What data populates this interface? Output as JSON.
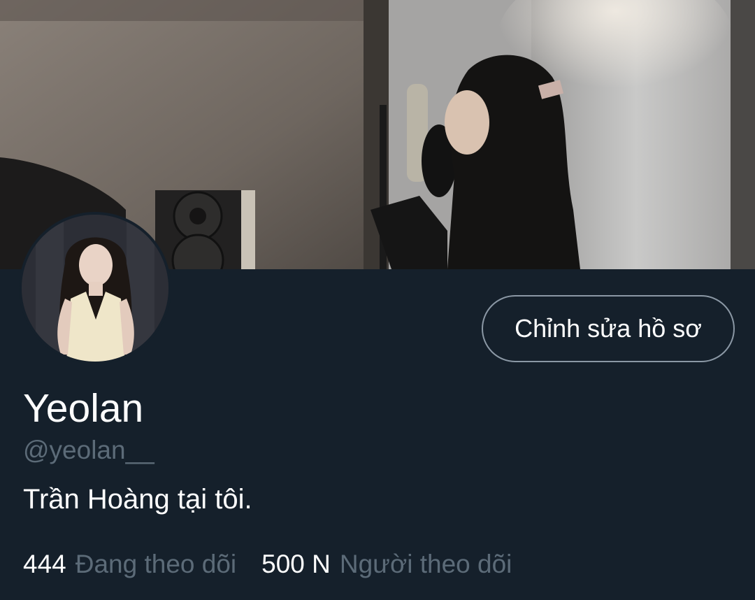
{
  "profile": {
    "display_name": "Yeolan",
    "handle": "@yeolan__",
    "bio": "Trần Hoàng tại tôi.",
    "edit_button_label": "Chỉnh sửa hồ sơ"
  },
  "stats": {
    "following_count": "444",
    "following_label": "Đang theo dõi",
    "followers_count": "500 N",
    "followers_label": "Người theo dõi"
  },
  "theme": {
    "background": "#15202b",
    "primary_text": "#ffffff",
    "secondary_text": "#5c6b78",
    "button_border": "#8b98a5"
  },
  "images": {
    "banner": "recording-studio-photo",
    "avatar": "profile-photo"
  }
}
